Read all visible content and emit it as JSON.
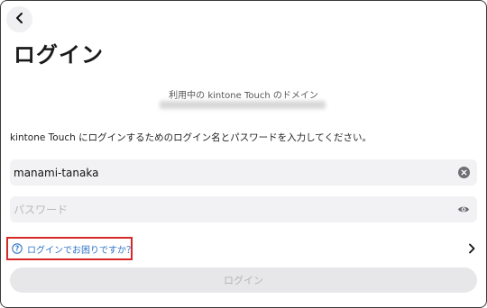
{
  "header": {
    "back_icon": "chevron-left-icon",
    "title": "ログイン"
  },
  "domain": {
    "label": "利用中の kintone Touch のドメイン"
  },
  "instruction": "kintone Touch にログインするためのログイン名とパスワードを入力してください。",
  "username": {
    "value": "manami-tanaka",
    "clear_icon": "clear-circle-icon"
  },
  "password": {
    "placeholder": "パスワード",
    "toggle_icon": "eye-icon"
  },
  "help": {
    "icon": "question-circle-icon",
    "label": "ログインでお困りですか？",
    "chevron_icon": "chevron-right-icon",
    "highlight_color": "#d62828",
    "link_color": "#2f74c7"
  },
  "login_button": {
    "label": "ログイン",
    "state": "disabled"
  }
}
